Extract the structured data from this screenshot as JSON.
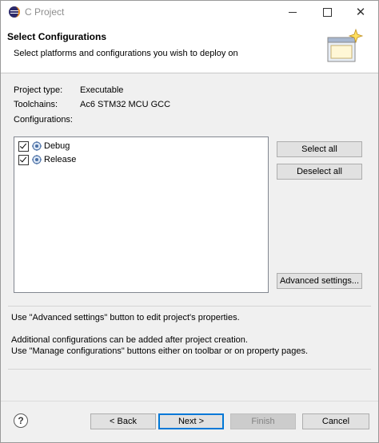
{
  "window": {
    "title": "C Project",
    "minimize_icon": "minimize-icon",
    "maximize_icon": "maximize-icon",
    "close_icon": "close-icon",
    "close_glyph": "✕"
  },
  "header": {
    "title": "Select Configurations",
    "description": "Select platforms and configurations you wish to deploy on"
  },
  "project": {
    "type_label": "Project type:",
    "type_value": "Executable",
    "toolchains_label": "Toolchains:",
    "toolchains_value": "Ac6 STM32 MCU GCC",
    "configurations_label": "Configurations:"
  },
  "configurations": [
    {
      "name": "Debug",
      "checked": true
    },
    {
      "name": "Release",
      "checked": true
    }
  ],
  "side_buttons": {
    "select_all": "Select all",
    "deselect_all": "Deselect all",
    "advanced_settings": "Advanced settings..."
  },
  "messages": {
    "line1": "Use \"Advanced settings\" button to edit project's properties.",
    "line2": "Additional configurations can be added after project creation.",
    "line3": "Use \"Manage configurations\" buttons either on toolbar or on property pages."
  },
  "footer": {
    "help_glyph": "?",
    "back": "< Back",
    "next": "Next >",
    "finish": "Finish",
    "cancel": "Cancel"
  },
  "colors": {
    "accent": "#0078d7",
    "button_face": "#e1e1e1",
    "dialog_bg": "#f0f0f0"
  }
}
